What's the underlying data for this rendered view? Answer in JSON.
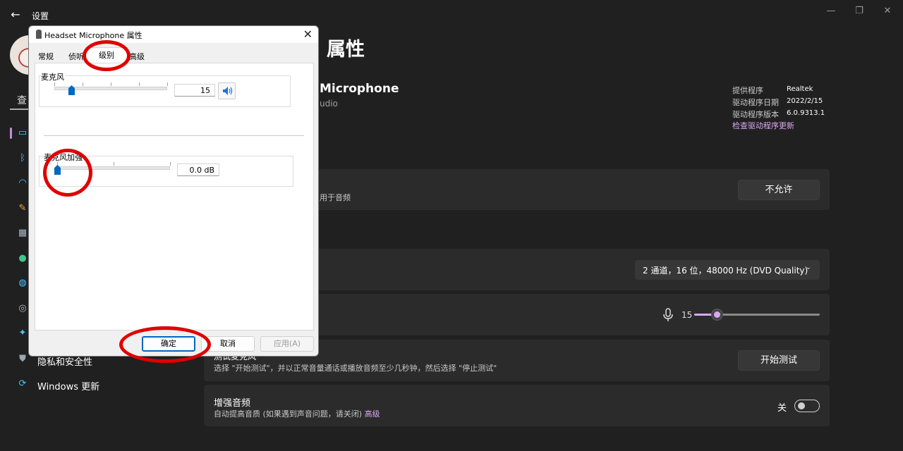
{
  "app": {
    "title": "设置"
  },
  "window_controls": {
    "minimize": "—",
    "maximize": "❐",
    "close": "✕"
  },
  "search": {
    "text": "查"
  },
  "sidebar": {
    "items": [
      {
        "icon": "monitor-icon",
        "label": ""
      },
      {
        "icon": "bluetooth-icon",
        "label": ""
      },
      {
        "icon": "wifi-icon",
        "label": ""
      },
      {
        "icon": "brush-icon",
        "label": ""
      },
      {
        "icon": "apps-icon",
        "label": ""
      },
      {
        "icon": "person-icon",
        "label": ""
      },
      {
        "icon": "globe-icon",
        "label": ""
      },
      {
        "icon": "gamepad-icon",
        "label": ""
      },
      {
        "icon": "accessibility-icon",
        "label": ""
      },
      {
        "icon": "shield-icon",
        "label": "隐私和安全性"
      },
      {
        "icon": "update-icon",
        "label": "Windows 更新"
      }
    ]
  },
  "page": {
    "title": "属性",
    "device_name": "Microphone",
    "device_sub": "udio"
  },
  "driver_info": {
    "provider_label": "提供程序",
    "provider_value": "Realtek",
    "date_label": "驱动程序日期",
    "date_value": "2022/2/15",
    "version_label": "驱动程序版本",
    "version_value": "6.0.9313.1",
    "check_link": "检查驱动程序更新"
  },
  "audio_access": {
    "subtitle": "用于音频",
    "button": "不允许"
  },
  "format": {
    "value": "2 通道，16 位，48000 Hz (DVD Quality)",
    "chevron": "⌄"
  },
  "volume": {
    "value": "15",
    "level": 0.18
  },
  "test": {
    "title": "测试麦克风",
    "subtitle": "选择 \"开始测试\"，并以正常音量通话或播放音频至少几秒钟，然后选择 \"停止测试\"",
    "button": "开始测试"
  },
  "enhance": {
    "title": "增强音频",
    "subtitle": "自动提高音质 (如果遇到声音问题，请关闭) ",
    "link": "高级",
    "toggle_label": "关",
    "enabled": false
  },
  "dialog": {
    "title": "Headset Microphone 属性",
    "close": "✕",
    "tabs": [
      "常规",
      "侦听",
      "级别",
      "高级"
    ],
    "active_tab": "级别",
    "mic_group_label": "麦克风",
    "mic_level": 15,
    "mic_value": "15",
    "boost_group_label": "麦克风加强",
    "boost_value": "0.0 dB",
    "ok": "确定",
    "cancel": "取消",
    "apply": "应用(A)"
  },
  "colors": {
    "accent": "#d9a8f0",
    "background": "#202020",
    "card": "#2b2b2b",
    "annotation": "#e00000",
    "win_accent": "#0067c0"
  }
}
